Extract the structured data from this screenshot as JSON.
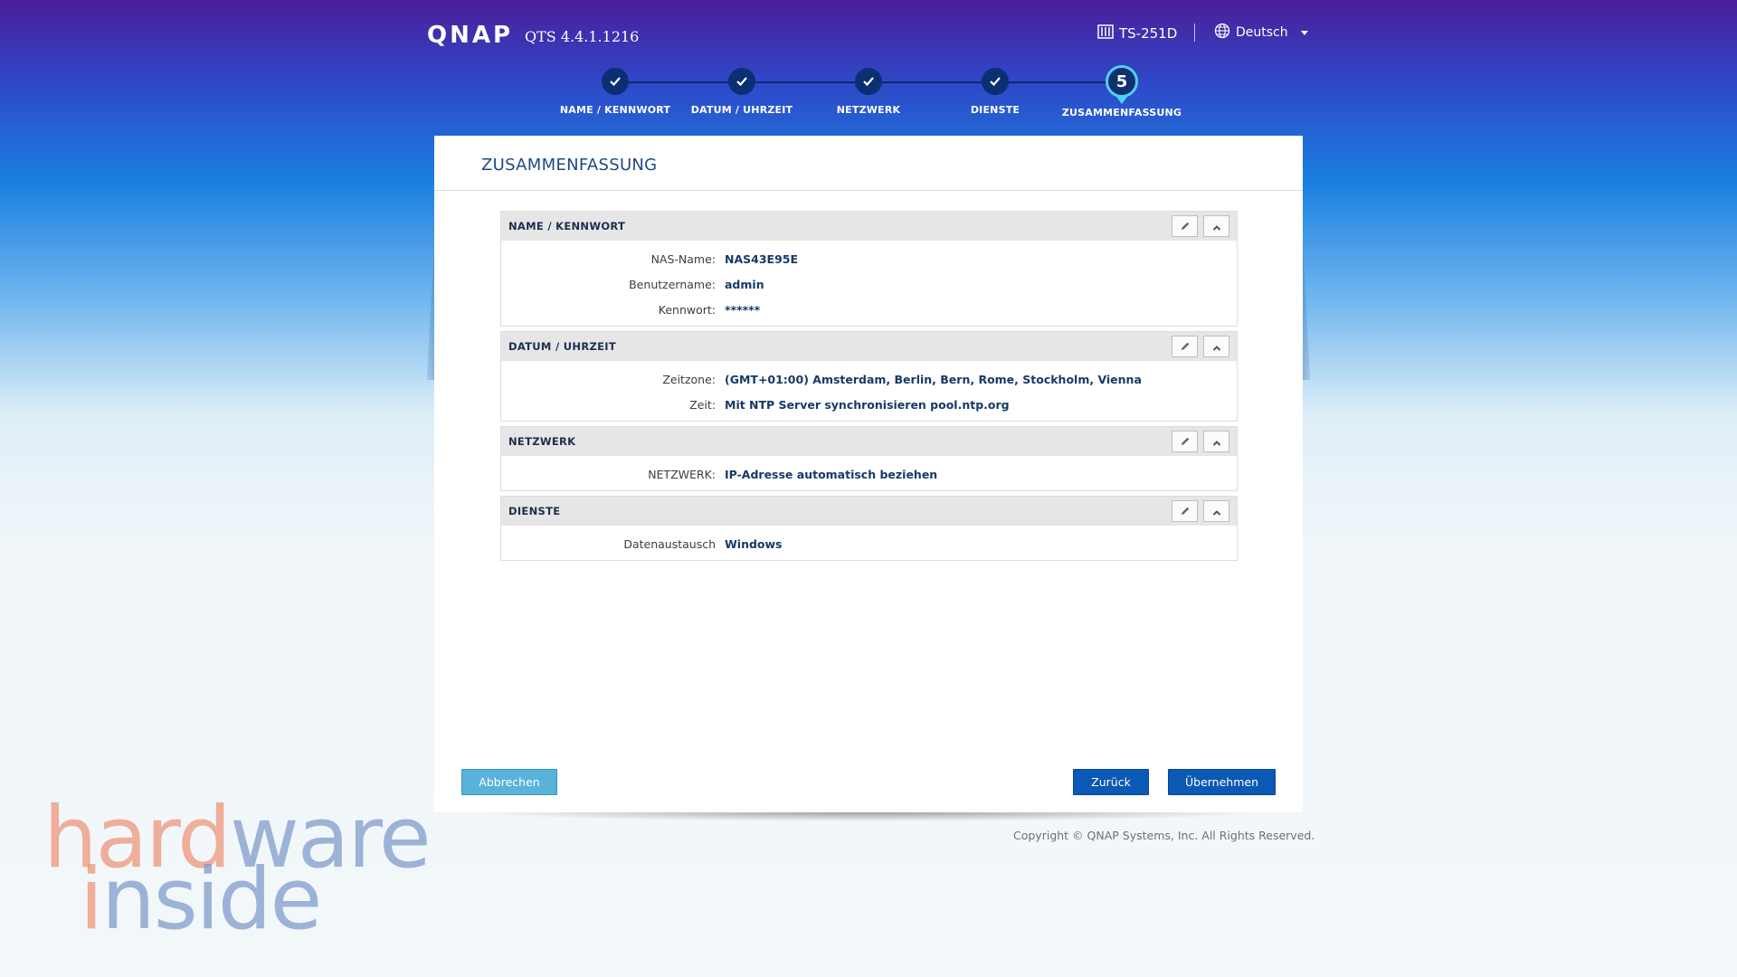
{
  "header": {
    "logo": "QNAP",
    "version": "QTS 4.4.1.1216",
    "model": "TS-251D",
    "language": "Deutsch",
    "model_icon": "nas-icon",
    "language_icon": "globe-icon"
  },
  "stepper": {
    "steps": [
      {
        "label": "NAME / KENNWORT",
        "state": "done"
      },
      {
        "label": "DATUM / UHRZEIT",
        "state": "done"
      },
      {
        "label": "NETZWERK",
        "state": "done"
      },
      {
        "label": "DIENSTE",
        "state": "done"
      },
      {
        "label": "ZUSAMMENFASSUNG",
        "state": "active",
        "number": "5"
      }
    ]
  },
  "panel": {
    "title": "ZUSAMMENFASSUNG",
    "sections": [
      {
        "title": "NAME / KENNWORT",
        "rows": [
          {
            "label": "NAS-Name:",
            "value": "NAS43E95E"
          },
          {
            "label": "Benutzername:",
            "value": "admin"
          },
          {
            "label": "Kennwort:",
            "value": "******"
          }
        ]
      },
      {
        "title": "DATUM / UHRZEIT",
        "rows": [
          {
            "label": "Zeitzone:",
            "value": "(GMT+01:00) Amsterdam, Berlin, Bern, Rome, Stockholm, Vienna"
          },
          {
            "label": "Zeit:",
            "value": "Mit NTP Server synchronisieren pool.ntp.org"
          }
        ]
      },
      {
        "title": "NETZWERK",
        "rows": [
          {
            "label": "NETZWERK:",
            "value": "IP-Adresse automatisch beziehen"
          }
        ]
      },
      {
        "title": "DIENSTE",
        "rows": [
          {
            "label": "Datenaustausch",
            "value": "Windows"
          }
        ]
      }
    ]
  },
  "buttons": {
    "cancel": "Abbrechen",
    "back": "Zurück",
    "apply": "Übernehmen"
  },
  "footer": {
    "copyright": "Copyright © QNAP Systems, Inc. All Rights Reserved."
  },
  "watermark": {
    "line1_a": "hard",
    "line1_b": "w",
    "line1_c": "are",
    "line2_a": "i",
    "line2_b": "nside"
  },
  "colors": {
    "accent": "#0a59b4",
    "step_active_ring": "#4fd1f0",
    "cancel_button": "#58b3da"
  }
}
